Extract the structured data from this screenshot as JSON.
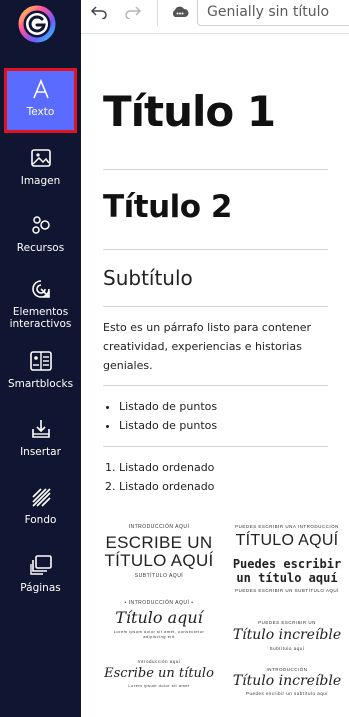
{
  "app": {
    "document_title": "Genially sin título"
  },
  "sidebar": {
    "items": [
      {
        "label": "Texto",
        "icon": "text-icon",
        "active": true
      },
      {
        "label": "Imagen",
        "icon": "image-icon"
      },
      {
        "label": "Recursos",
        "icon": "resources-icon"
      },
      {
        "label": "Elementos interactivos",
        "icon": "interactive-icon"
      },
      {
        "label": "Smartblocks",
        "icon": "smartblocks-icon"
      },
      {
        "label": "Insertar",
        "icon": "insert-icon"
      },
      {
        "label": "Fondo",
        "icon": "background-icon"
      },
      {
        "label": "Páginas",
        "icon": "pages-icon"
      }
    ]
  },
  "text_panel": {
    "title1": "Título 1",
    "title2": "Título 2",
    "subtitle": "Subtítulo",
    "paragraph": "Esto es un párrafo listo para contener creatividad, experiencias e historias geniales.",
    "bullets": [
      "Listado de puntos",
      "Listado de puntos"
    ],
    "ordered": [
      "Listado ordenado",
      "Listado ordenado"
    ]
  },
  "templates": [
    {
      "top": "INTRODUCCIÓN AQUÍ",
      "main": "ESCRIBE UN TÍTULO AQUÍ",
      "bottom": "SUBTÍTULO AQUÍ"
    },
    {
      "top": "PUEDES ESCRIBIR UNA INTRODUCCIÓN",
      "main": "TÍTULO AQUÍ",
      "second": "Puedes escribir un título aquí",
      "bottom": "PUEDES ESCRIBIR UN SUBTÍTULO AQUÍ"
    },
    {
      "top": "• INTRODUCCIÓN AQUÍ •",
      "main": "Título aquí",
      "bottom": "Lorem ipsum dolor sit amet, consectetur adipiscing elit"
    },
    {
      "top": "PUEDES ESCRIBIR UN",
      "main": "Título increíble",
      "bottom": "Subtítulo aquí"
    },
    {
      "top": "Introducción aquí",
      "main": "Escribe un título",
      "bottom": "Lorem ipsum dolor sit amet"
    },
    {
      "top": "INTRODUCCIÓN",
      "main": "Título increíble",
      "bottom": "Puedes escribir un subtítulo aquí"
    }
  ]
}
